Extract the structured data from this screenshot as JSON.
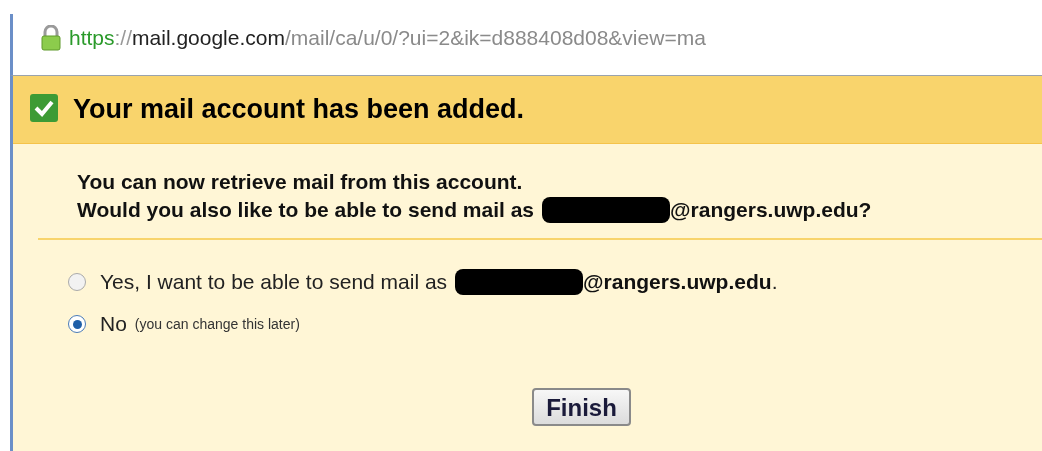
{
  "address_bar": {
    "scheme": "https",
    "separator": "://",
    "host": "mail.google.com",
    "path": "/mail/ca/u/0/?ui=2&ik=d888408d08&view=ma"
  },
  "banner": {
    "title": "Your mail account has been added."
  },
  "message": {
    "line_1": "You can now retrieve mail from this account.",
    "line_2_before": "Would you also like to be able to send mail as",
    "line_2_after": "@rangers.uwp.edu?"
  },
  "options": [
    {
      "label": "Yes, I want to be able to send mail as",
      "address": "@rangers.uwp.edu",
      "end": ".",
      "selected": false
    },
    {
      "label": "No",
      "note": "(you can change this later)",
      "selected": true
    }
  ],
  "buttons": [
    {
      "label": "Finish"
    }
  ]
}
